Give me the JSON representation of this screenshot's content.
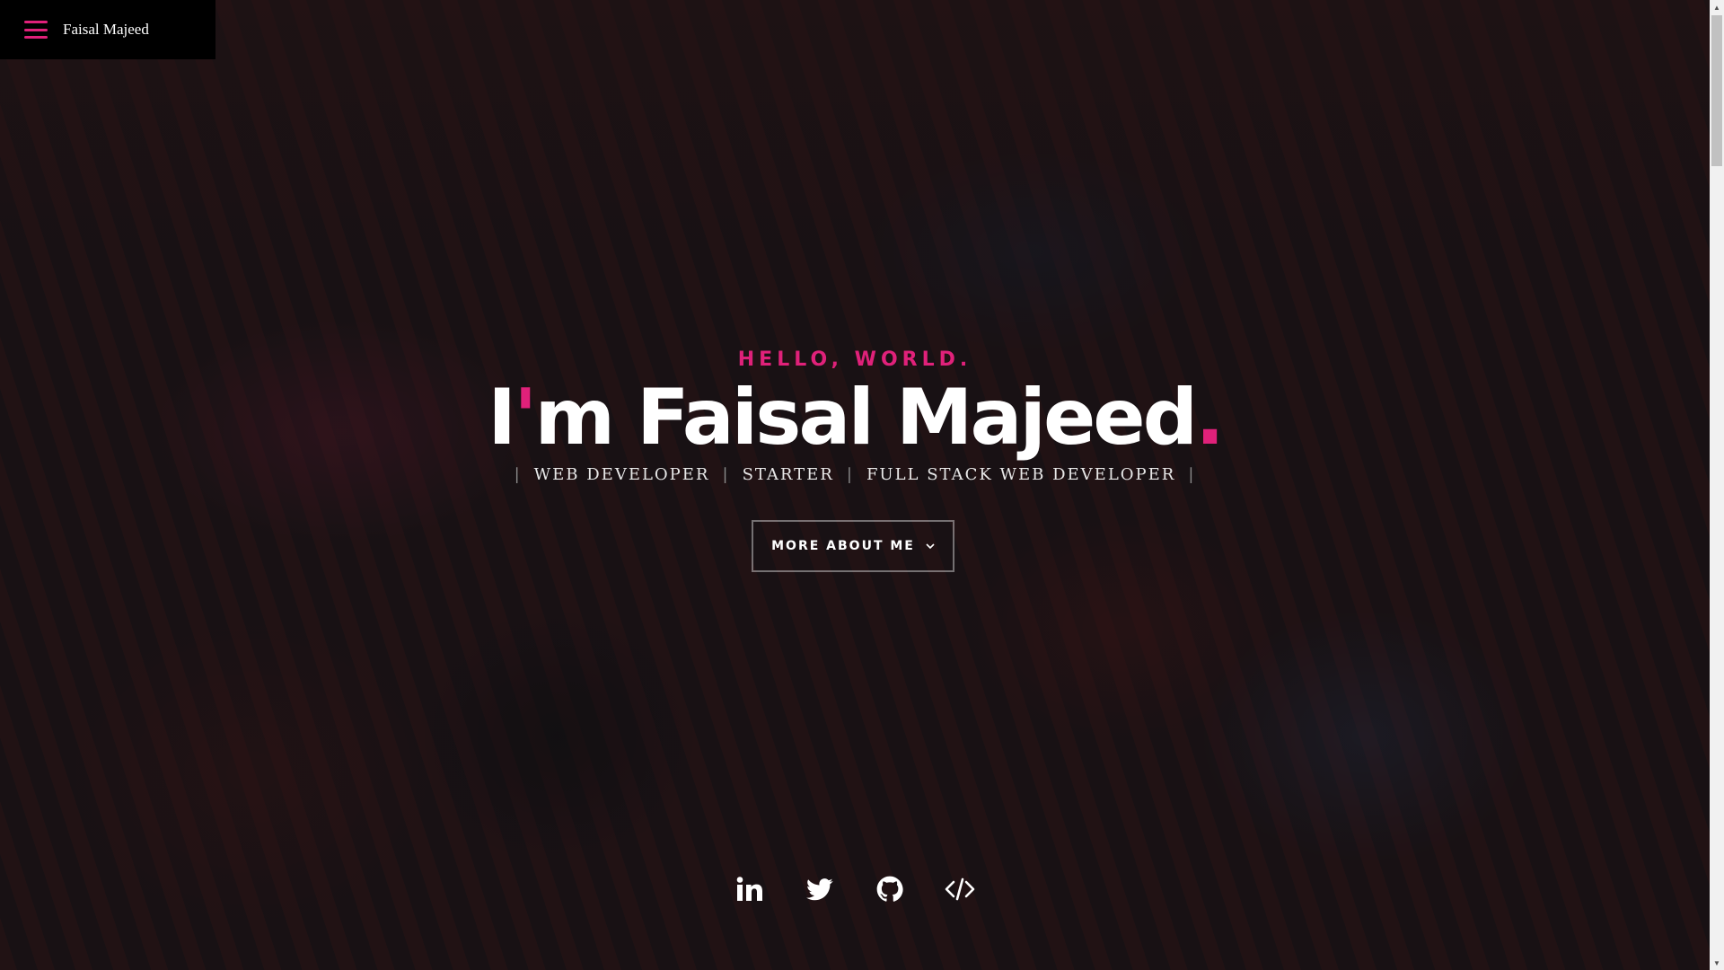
{
  "nav": {
    "brand": "Faisal Majeed",
    "menu_icon": "hamburger-menu-icon",
    "accent": "#e0217a"
  },
  "hero": {
    "pretitle": "HELLO, WORLD.",
    "title_prefix": "I",
    "title_apostrophe": "'",
    "title_rest": "m Faisal Majeed",
    "title_period": ".",
    "roles": [
      "WEB DEVELOPER",
      "STARTER",
      "FULL STACK WEB DEVELOPER"
    ],
    "role_separator": "|",
    "more_button_label": "MORE ABOUT ME",
    "more_button_icon": "chevron-down-icon"
  },
  "socials": [
    {
      "icon": "linkedin-icon"
    },
    {
      "icon": "twitter-icon"
    },
    {
      "icon": "github-icon"
    },
    {
      "icon": "code-icon"
    }
  ],
  "colors": {
    "accent": "#e0217a",
    "text": "#ffffff"
  }
}
